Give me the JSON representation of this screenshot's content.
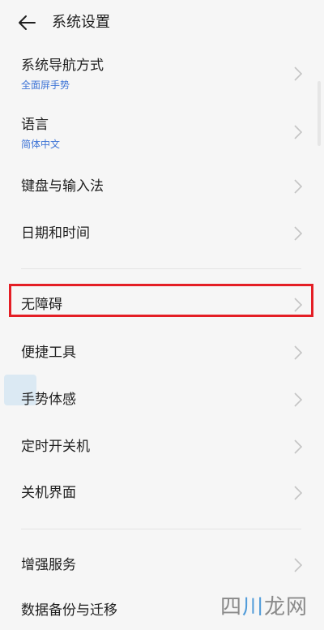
{
  "header": {
    "title": "系统设置",
    "back_icon": "back-arrow-icon"
  },
  "settings": {
    "items": [
      {
        "label": "系统导航方式",
        "subtitle": "全面屏手势"
      },
      {
        "label": "语言",
        "subtitle": "简体中文"
      },
      {
        "label": "键盘与输入法"
      },
      {
        "label": "日期和时间"
      },
      {
        "label": "无障碍",
        "highlighted": true
      },
      {
        "label": "便捷工具"
      },
      {
        "label": "手势体感"
      },
      {
        "label": "定时开关机"
      },
      {
        "label": "关机界面"
      },
      {
        "label": "增强服务"
      },
      {
        "label": "数据备份与迁移"
      }
    ],
    "chevron_icon": "chevron-right-icon"
  },
  "watermark": {
    "part1": "四",
    "part2": "川",
    "part3": "龙网"
  },
  "colors": {
    "background": "#f6f6f6",
    "subtitle": "#3e74d6",
    "highlight_border": "#e41e25"
  }
}
